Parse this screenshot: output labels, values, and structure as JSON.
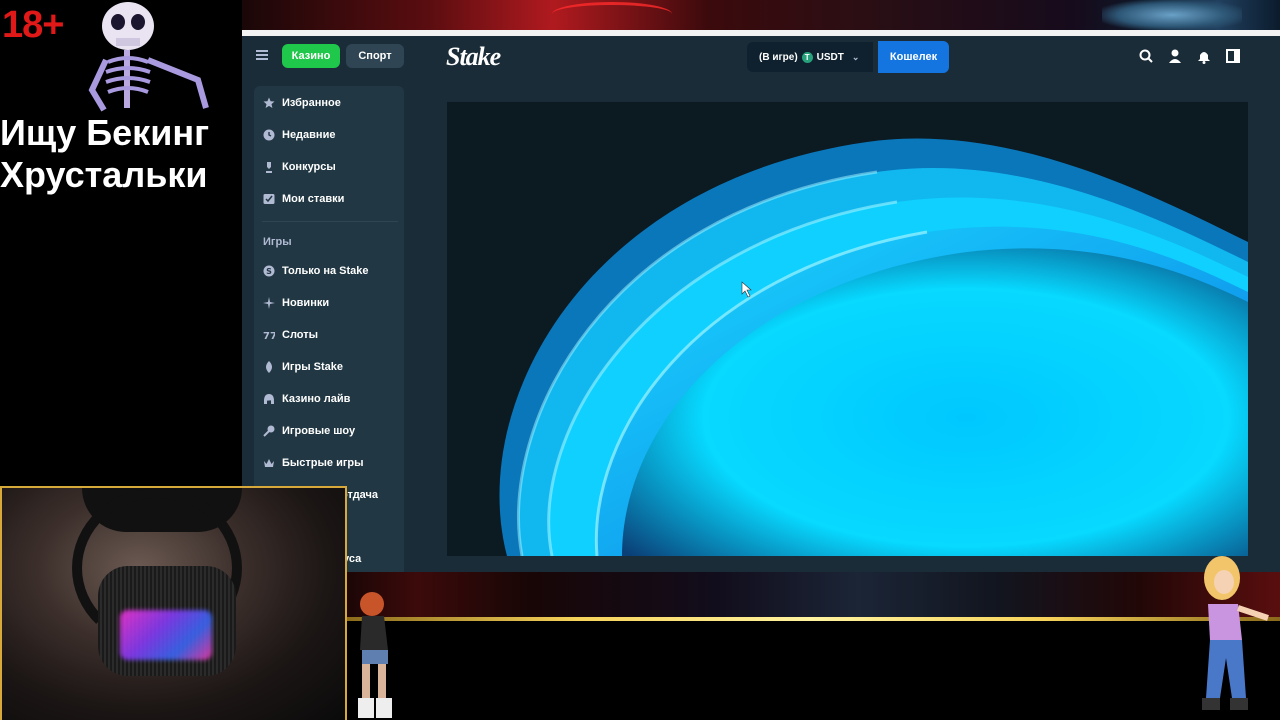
{
  "overlay": {
    "age_badge": "18+",
    "title_line1": "Ищу Бекинг",
    "title_line2": "Хрустальки"
  },
  "header": {
    "casino_tab": "Казино",
    "sport_tab": "Спорт",
    "logo": "Stake",
    "balance_label": "(В игре)",
    "currency_icon": "tether-icon",
    "currency": "USDT",
    "wallet_button": "Кошелек",
    "icons": [
      "search-icon",
      "user-icon",
      "bell-icon",
      "sidebar-toggle-icon"
    ]
  },
  "sidebar": {
    "top_items": [
      {
        "label": "Избранное",
        "icon": "star-icon"
      },
      {
        "label": "Недавние",
        "icon": "clock-icon"
      },
      {
        "label": "Конкурсы",
        "icon": "trophy-icon"
      },
      {
        "label": "Мои ставки",
        "icon": "bets-icon"
      }
    ],
    "games_heading": "Игры",
    "game_items": [
      {
        "label": "Только на Stake",
        "icon": "stake-exclusive-icon"
      },
      {
        "label": "Новинки",
        "icon": "sparkle-icon"
      },
      {
        "label": "Слоты",
        "icon": "slots-icon"
      },
      {
        "label": "Игры Stake",
        "icon": "stake-originals-icon"
      },
      {
        "label": "Казино лайв",
        "icon": "live-casino-icon"
      },
      {
        "label": "Игровые шоу",
        "icon": "microphone-icon"
      },
      {
        "label": "Быстрые игры",
        "icon": "crown-icon"
      }
    ],
    "partial_items": [
      "отдача",
      "уса"
    ]
  },
  "colors": {
    "app_bg": "#1a2c38",
    "sidebar_bg": "#213743",
    "casino_green": "#1fc74a",
    "wallet_blue": "#1475e1",
    "age_red": "#e01818",
    "webcam_border": "#d7a83a"
  }
}
